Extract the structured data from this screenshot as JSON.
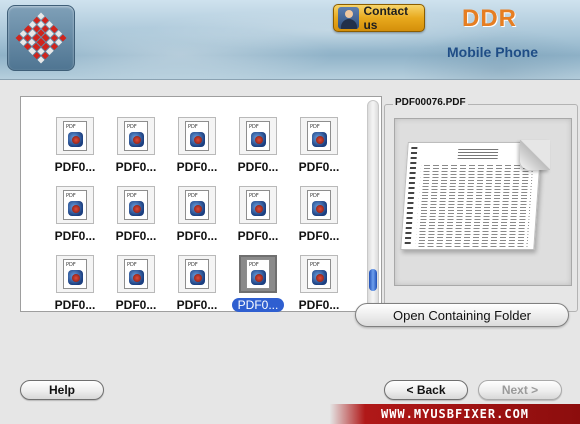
{
  "header": {
    "contact_label": "Contact us",
    "brand": "DDR",
    "product": "Mobile Phone"
  },
  "files": [
    {
      "label": "PDF0...",
      "selected": false
    },
    {
      "label": "PDF0...",
      "selected": false
    },
    {
      "label": "PDF0...",
      "selected": false
    },
    {
      "label": "PDF0...",
      "selected": false
    },
    {
      "label": "PDF0...",
      "selected": false
    },
    {
      "label": "PDF0...",
      "selected": false
    },
    {
      "label": "PDF0...",
      "selected": false
    },
    {
      "label": "PDF0...",
      "selected": false
    },
    {
      "label": "PDF0...",
      "selected": false
    },
    {
      "label": "PDF0...",
      "selected": false
    },
    {
      "label": "PDF0...",
      "selected": false
    },
    {
      "label": "PDF0...",
      "selected": false
    },
    {
      "label": "PDF0...",
      "selected": false
    },
    {
      "label": "PDF0...",
      "selected": true
    },
    {
      "label": "PDF0...",
      "selected": false
    }
  ],
  "preview": {
    "filename": "PDF00076.PDF",
    "open_folder_label": "Open Containing Folder"
  },
  "footer": {
    "help_label": "Help",
    "back_label": "< Back",
    "next_label": "Next >",
    "website": "WWW.MYUSBFIXER.COM"
  },
  "colors": {
    "selection": "#2f5fd0",
    "brand_orange": "#e67e22",
    "product_blue": "#1f4d86",
    "website_band": "#8c0d0d"
  }
}
